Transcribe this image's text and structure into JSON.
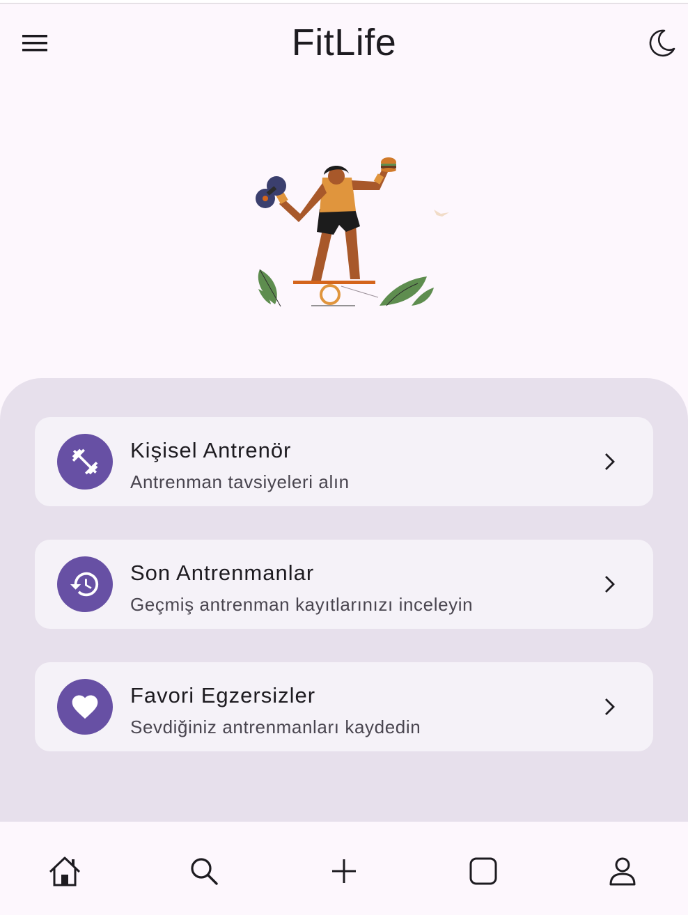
{
  "app": {
    "title": "FitLife"
  },
  "header": {
    "menu_icon": "menu-icon",
    "theme_icon": "moon-icon"
  },
  "hero": {
    "illustration": "person-balancing-with-dumbbell-and-burger"
  },
  "cards": [
    {
      "title": "Kişisel Antrenör",
      "subtitle": "Antrenman tavsiyeleri alın",
      "icon": "fitness-icon"
    },
    {
      "title": "Son Antrenmanlar",
      "subtitle": "Geçmiş antrenman kayıtlarınızı inceleyin",
      "icon": "history-icon"
    },
    {
      "title": "Favori Egzersizler",
      "subtitle": "Sevdiğiniz antrenmanları kaydedin",
      "icon": "heart-icon"
    }
  ],
  "bottom_nav": {
    "items": [
      "home-icon",
      "search-icon",
      "add-icon",
      "square-icon",
      "profile-icon"
    ]
  },
  "colors": {
    "accent": "#6750a4",
    "panel": "#e7e0ec",
    "card": "#f5f2f8",
    "background": "#fdf7fd"
  }
}
